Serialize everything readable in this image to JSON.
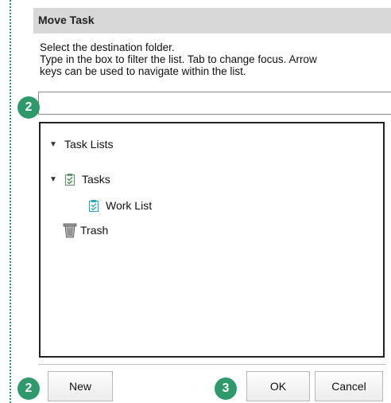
{
  "dialog": {
    "title": "Move Task",
    "instructions": [
      "Select the destination folder.",
      "Type in the box to filter the list. Tab to change focus. Arrow",
      "keys can be used to navigate within the list."
    ],
    "filter": {
      "value": "",
      "placeholder": ""
    }
  },
  "tree": {
    "root": {
      "label": "Task Lists",
      "expanded": true
    },
    "items": [
      {
        "label": "Tasks",
        "icon": "task-list-icon",
        "expanded": true
      },
      {
        "label": "Work List",
        "icon": "task-list-icon"
      },
      {
        "label": "Trash",
        "icon": "trash-icon"
      }
    ]
  },
  "buttons": {
    "new_label": "New",
    "ok_label": "OK",
    "cancel_label": "Cancel"
  },
  "callouts": [
    {
      "number": "2"
    },
    {
      "number": "2"
    },
    {
      "number": "3"
    }
  ],
  "colors": {
    "callout": "#2e9a6c",
    "title_bar": "#d8d8d8",
    "list_icon": "#2aa7b8"
  }
}
